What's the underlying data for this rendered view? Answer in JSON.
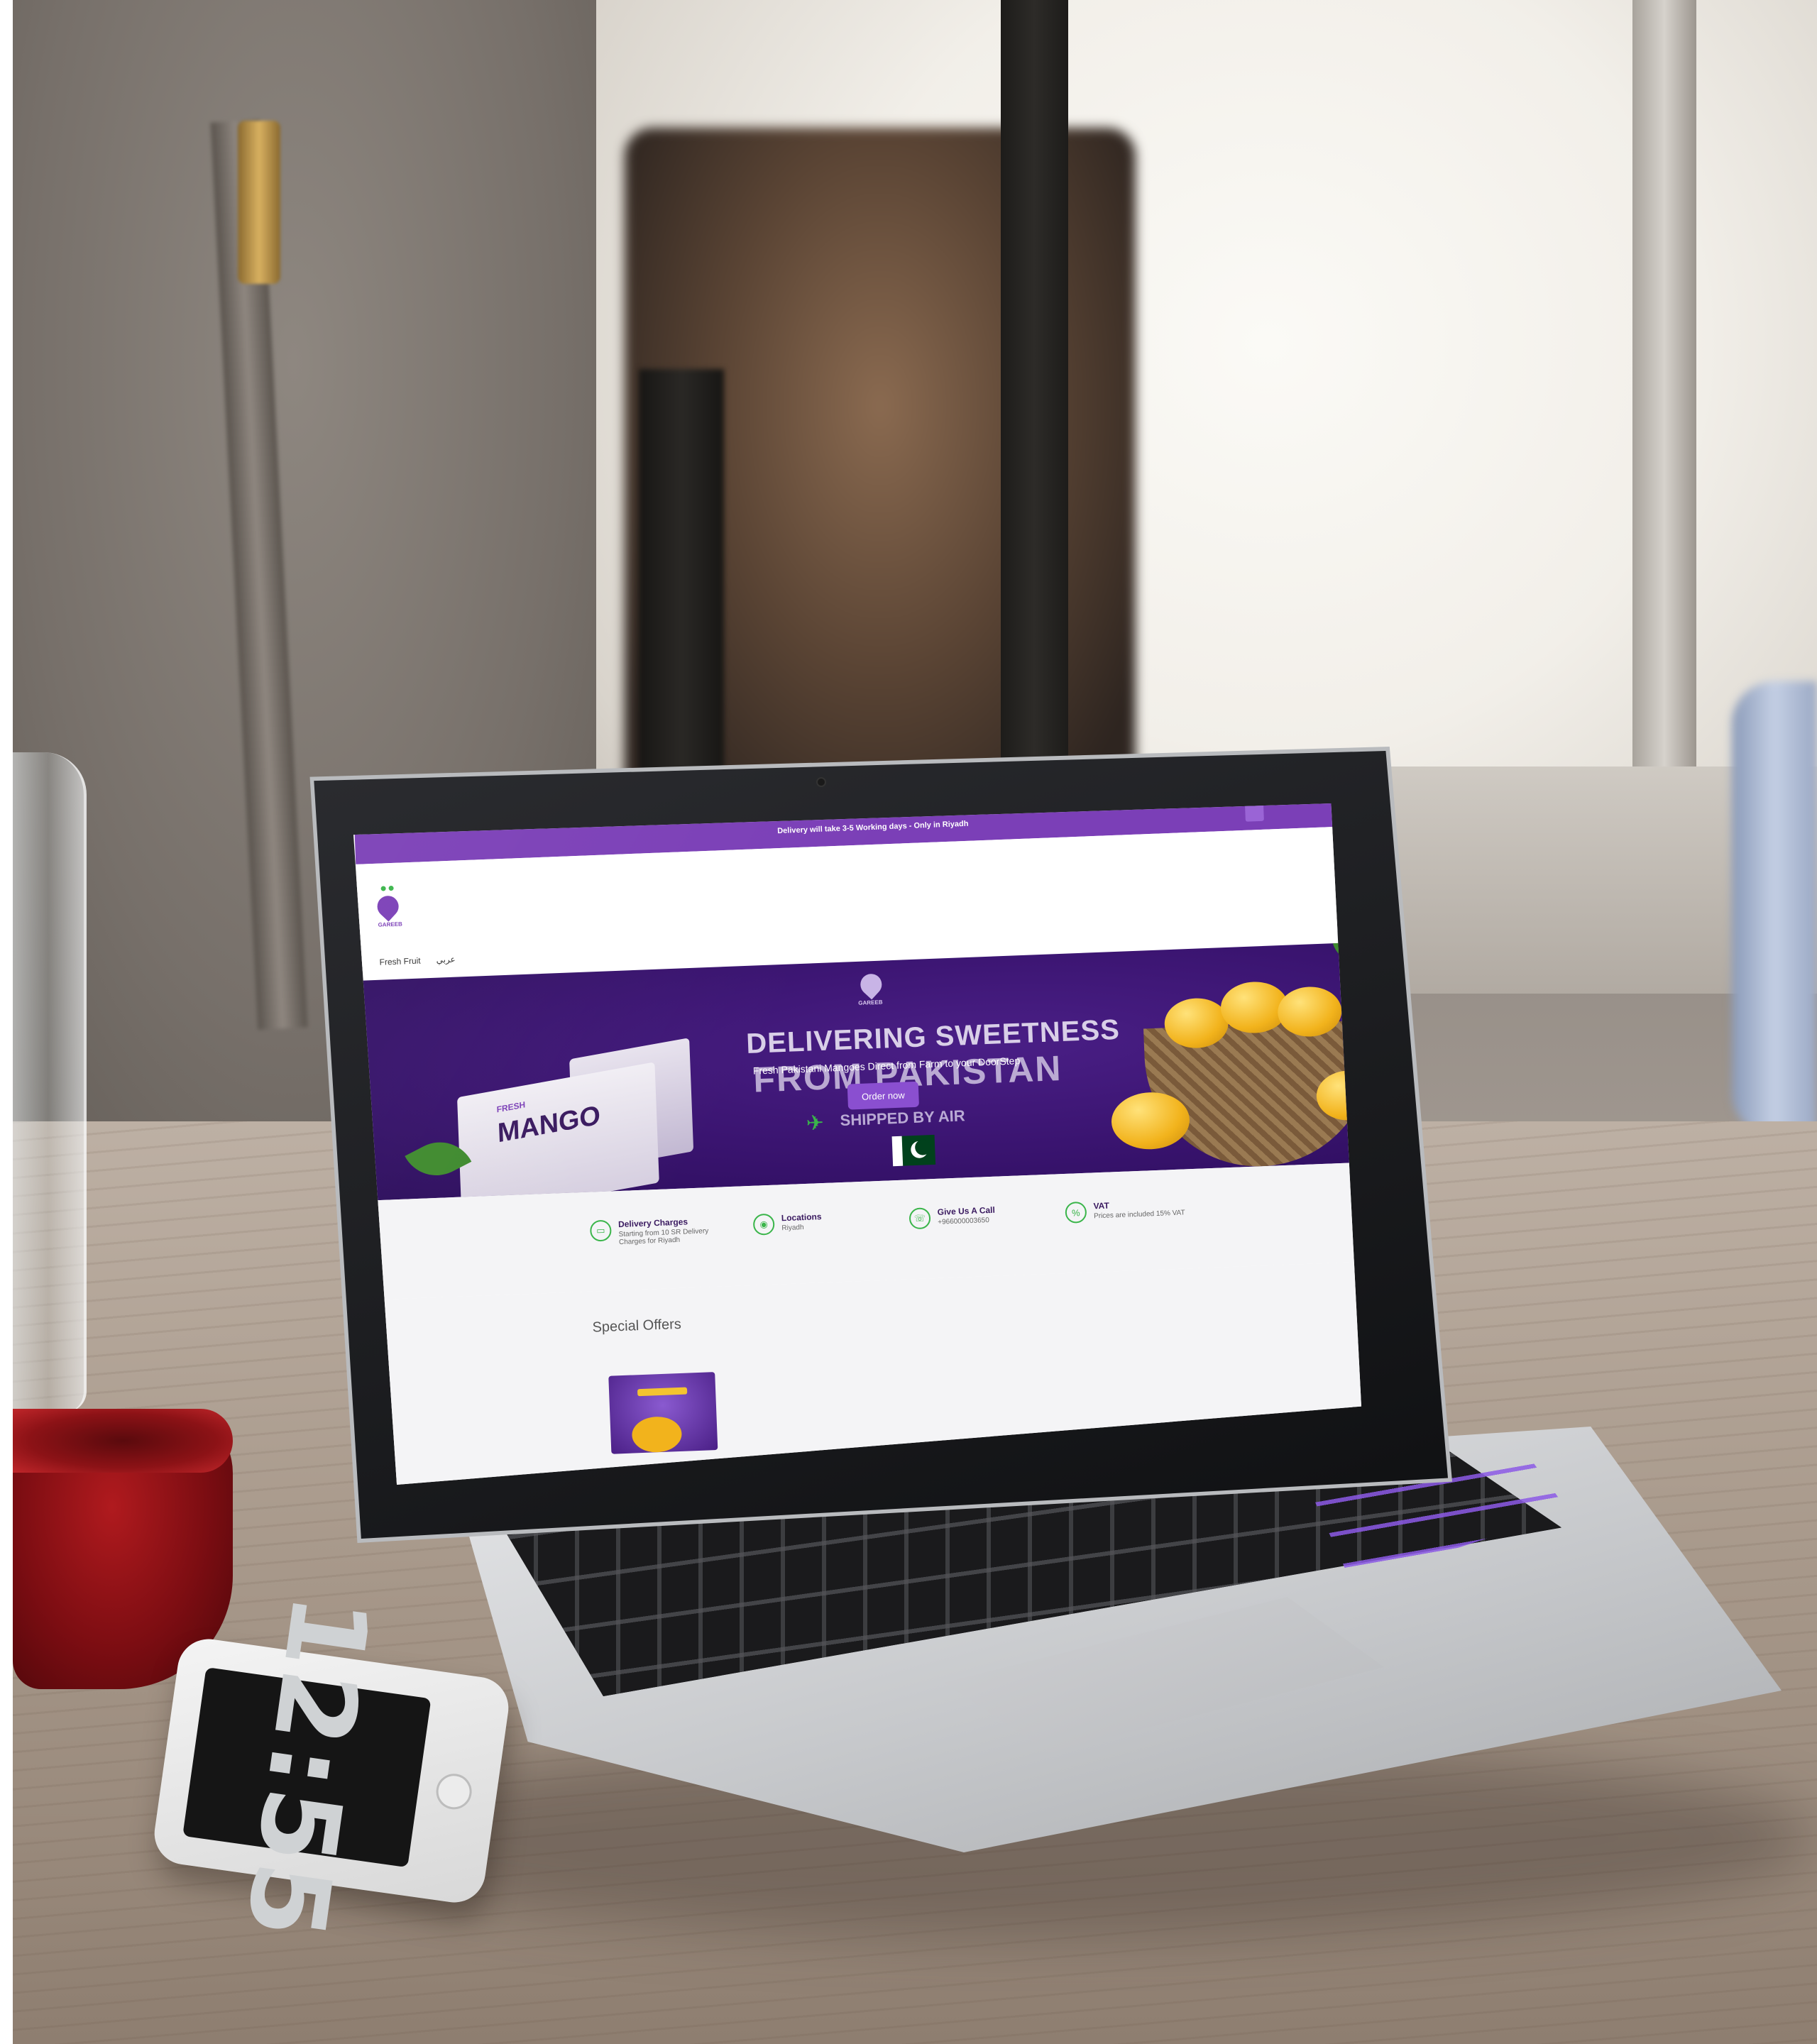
{
  "website": {
    "announcement": "Delivery will take 3-5 Working days - Only in Riyadh",
    "logo_text": "GAREEB",
    "nav": [
      "Fresh Fruit",
      "عربي"
    ],
    "hero": {
      "logo_text": "GAREEB",
      "title_line_1": "DELIVERING SWEETNESS",
      "title_line_2": "FROM PAKISTAN",
      "subtitle": "Fresh Pakistani Mangoes Direct from Farm to your DoorStep",
      "cta_label": "Order now",
      "shipped_label": "SHIPPED BY AIR",
      "box_label": "MANGO",
      "box_brand": "FRESH"
    },
    "features": [
      {
        "icon": "truck-icon",
        "title": "Delivery Charges",
        "desc": "Starting from 10 SR Delivery Charges for Riyadh"
      },
      {
        "icon": "location-pin-icon",
        "title": "Locations",
        "desc": "Riyadh"
      },
      {
        "icon": "phone-icon",
        "title": "Give Us A Call",
        "desc": "+966000003650"
      },
      {
        "icon": "percent-icon",
        "title": "VAT",
        "desc": "Prices are included 15% VAT"
      }
    ],
    "offers_title": "Special Offers"
  },
  "phone": {
    "time": "12:55"
  },
  "colors": {
    "brand_purple": "#7b3fb7",
    "hero_purple": "#3a1470",
    "accent_green": "#3ab54a"
  }
}
